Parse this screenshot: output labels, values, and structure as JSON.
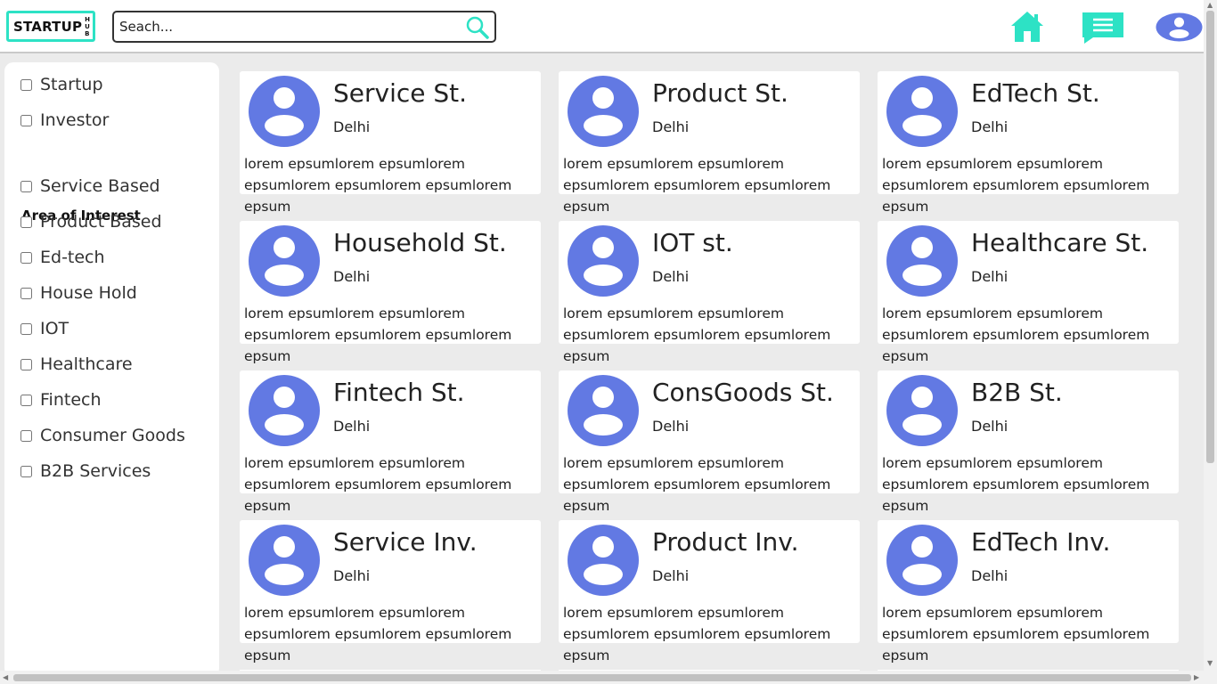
{
  "header": {
    "logo_main": "STARTUP",
    "logo_sub": [
      "H",
      "U",
      "B"
    ],
    "search_placeholder": "Seach...",
    "icons": [
      "search-icon",
      "home-icon",
      "chat-icon",
      "user-avatar-icon"
    ],
    "accent": "#2de2c5",
    "avatar_color": "#6279e3"
  },
  "sidebar": {
    "filters": [
      "Startup",
      "Investor"
    ],
    "area_heading": "Area of Interest",
    "areas": [
      "Service Based",
      "Product Based",
      "Ed-tech",
      "House Hold",
      "IOT",
      "Healthcare",
      "Fintech",
      "Consumer Goods",
      "B2B Services"
    ]
  },
  "cards": [
    {
      "title": "Service St.",
      "location": "Delhi",
      "description": "lorem epsumlorem epsumlorem epsumlorem epsumlorem epsumlorem epsum"
    },
    {
      "title": "Product St.",
      "location": "Delhi",
      "description": "lorem epsumlorem epsumlorem epsumlorem epsumlorem epsumlorem epsum"
    },
    {
      "title": "EdTech St.",
      "location": "Delhi",
      "description": "lorem epsumlorem epsumlorem epsumlorem epsumlorem epsumlorem epsum"
    },
    {
      "title": "Household St.",
      "location": "Delhi",
      "description": "lorem epsumlorem epsumlorem epsumlorem epsumlorem epsumlorem epsum"
    },
    {
      "title": "IOT st.",
      "location": "Delhi",
      "description": "lorem epsumlorem epsumlorem epsumlorem epsumlorem epsumlorem epsum"
    },
    {
      "title": "Healthcare St.",
      "location": "Delhi",
      "description": "lorem epsumlorem epsumlorem epsumlorem epsumlorem epsumlorem epsum"
    },
    {
      "title": "Fintech St.",
      "location": "Delhi",
      "description": "lorem epsumlorem epsumlorem epsumlorem epsumlorem epsumlorem epsum"
    },
    {
      "title": "ConsGoods St.",
      "location": "Delhi",
      "description": "lorem epsumlorem epsumlorem epsumlorem epsumlorem epsumlorem epsum"
    },
    {
      "title": "B2B St.",
      "location": "Delhi",
      "description": "lorem epsumlorem epsumlorem epsumlorem epsumlorem epsumlorem epsum"
    },
    {
      "title": "Service Inv.",
      "location": "Delhi",
      "description": "lorem epsumlorem epsumlorem epsumlorem epsumlorem epsumlorem epsum"
    },
    {
      "title": "Product Inv.",
      "location": "Delhi",
      "description": "lorem epsumlorem epsumlorem epsumlorem epsumlorem epsumlorem epsum"
    },
    {
      "title": "EdTech Inv.",
      "location": "Delhi",
      "description": "lorem epsumlorem epsumlorem epsumlorem epsumlorem epsumlorem epsum"
    }
  ]
}
